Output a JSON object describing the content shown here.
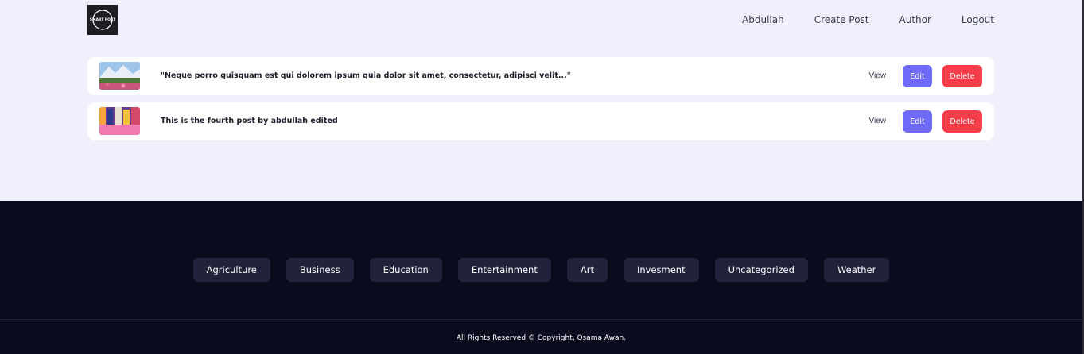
{
  "nav": {
    "logo_alt": "Smart Post logo",
    "links": [
      "Abdullah",
      "Create Post",
      "Author",
      "Logout"
    ]
  },
  "posts": [
    {
      "title": "\"Neque porro quisquam est qui dolorem ipsum quia dolor sit amet, consectetur, adipisci velit...\"",
      "view": "View",
      "edit": "Edit",
      "delete": "Delete"
    },
    {
      "title": "This is the fourth post by abdullah edited",
      "view": "View",
      "edit": "Edit",
      "delete": "Delete"
    }
  ],
  "footer": {
    "categories": [
      "Agriculture",
      "Business",
      "Education",
      "Entertainment",
      "Art",
      "Invesment",
      "Uncategorized",
      "Weather"
    ],
    "copyright": "All Rights Reserved © Copyright, Osama Awan."
  },
  "colors": {
    "page_bg": "#f0f0fc",
    "footer_bg": "#0b0b1e",
    "edit_button": "#6f6af8",
    "delete_button": "#f53e4a",
    "category_bg": "#22223a"
  }
}
